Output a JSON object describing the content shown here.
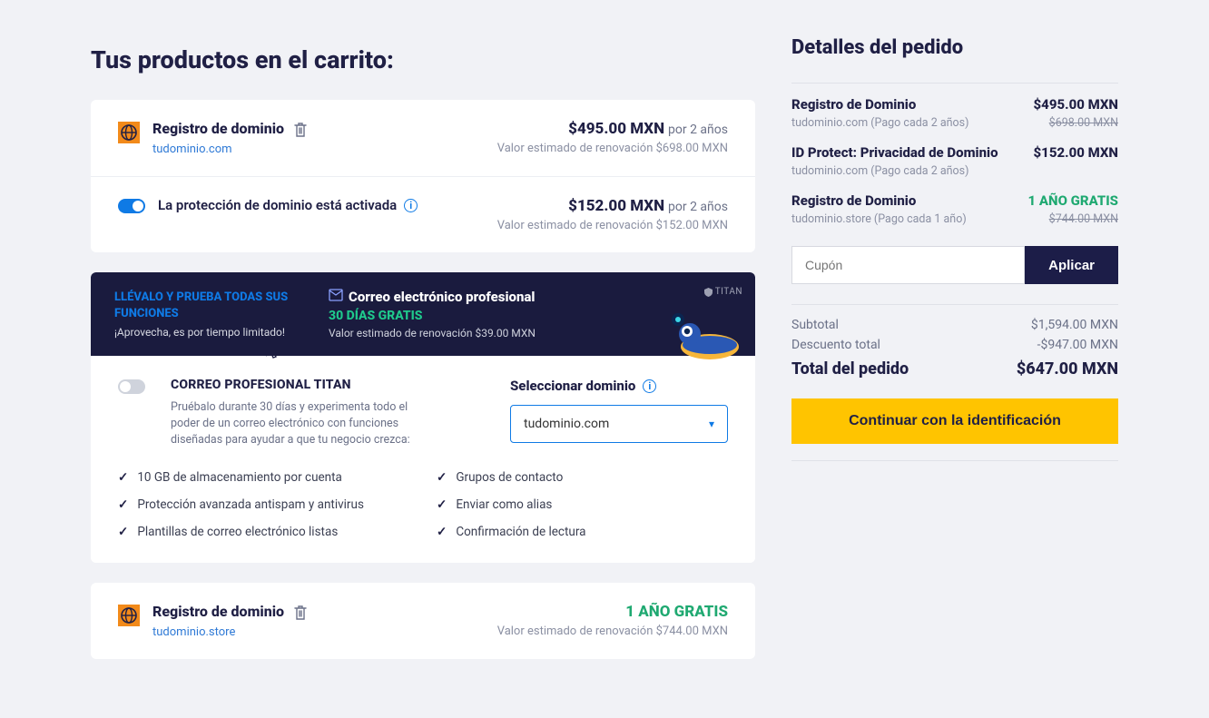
{
  "page": {
    "heading": "Tus productos en el carrito:"
  },
  "items": [
    {
      "title": "Registro de dominio",
      "sub": "tudominio.com",
      "price": "$495.00 MXN",
      "period": "por 2 años",
      "renew": "Valor estimado de renovación $698.00 MXN"
    }
  ],
  "protection": {
    "label": "La protección de dominio está activada",
    "price": "$152.00 MXN",
    "period": "por 2 años",
    "renew": "Valor estimado de renovación $152.00 MXN"
  },
  "promo": {
    "headline": "LLÉVALO Y PRUEBA TODAS SUS FUNCIONES",
    "sub": "¡Aprovecha, es por tiempo limitado!",
    "title": "Correo electrónico profesional",
    "green": "30 DÍAS GRATIS",
    "renew": "Valor estimado de renovación $39.00 MXN",
    "badge": "TITAN"
  },
  "titan": {
    "title": "CORREO PROFESIONAL TITAN",
    "desc": "Pruébalo durante 30 días y experimenta todo el poder de un correo electrónico con funciones diseñadas para ayudar a que tu negocio crezca:",
    "select_label": "Seleccionar dominio",
    "select_value": "tudominio.com",
    "features": [
      "10 GB de almacenamiento por cuenta",
      "Grupos de contacto",
      "Protección avanzada antispam y antivirus",
      "Enviar como alias",
      "Plantillas de correo electrónico listas",
      "Confirmación de lectura"
    ]
  },
  "item2": {
    "title": "Registro de dominio",
    "sub": "tudominio.store",
    "price": "1 AÑO GRATIS",
    "renew": "Valor estimado de renovación $744.00 MXN"
  },
  "summary": {
    "heading": "Detalles del pedido",
    "rows": [
      {
        "title": "Registro de Dominio",
        "sub": "tudominio.com (Pago cada 2 años)",
        "price": "$495.00 MXN",
        "strike": "$698.00 MXN"
      },
      {
        "title": "ID Protect: Privacidad de Dominio",
        "sub": "tudominio.com (Pago cada 2 años)",
        "price": "$152.00 MXN",
        "strike": ""
      },
      {
        "title": "Registro de Dominio",
        "sub": "tudominio.store (Pago cada 1 año)",
        "price_free": "1 AÑO GRATIS",
        "strike": "$744.00 MXN"
      }
    ],
    "coupon": {
      "placeholder": "Cupón",
      "button": "Aplicar"
    },
    "subtotal_label": "Subtotal",
    "subtotal_value": "$1,594.00 MXN",
    "discount_label": "Descuento total",
    "discount_value": "-$947.00 MXN",
    "total_label": "Total del pedido",
    "total_value": "$647.00 MXN",
    "cta": "Continuar con la identificación"
  }
}
